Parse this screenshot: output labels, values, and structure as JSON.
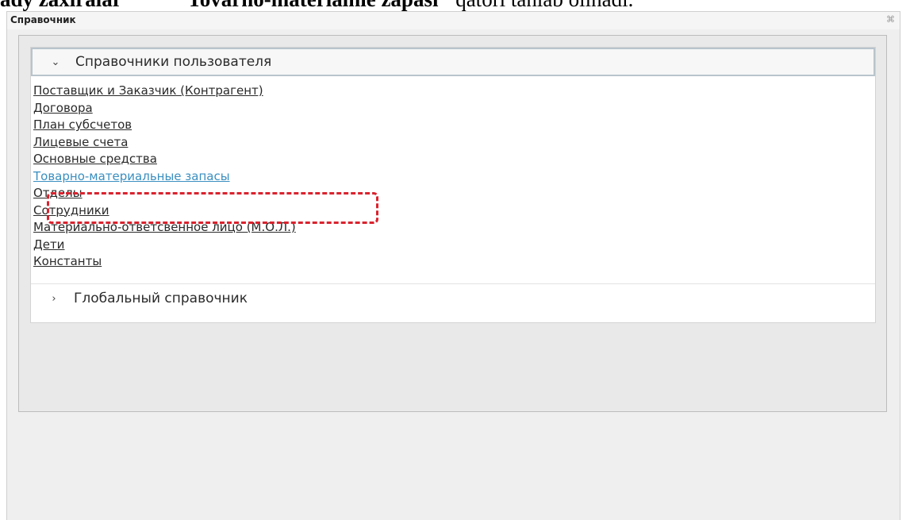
{
  "caption": {
    "part1": "ady zaxiralar",
    "part2": "\"Tovarno-materialnie zapasi\"",
    "part3": "qatori tanlab olinadi."
  },
  "window": {
    "title": "Справочник",
    "close_icon": "close-icon"
  },
  "sections": [
    {
      "label": "Справочники пользователя",
      "expanded": true,
      "items": [
        "Поставщик и Заказчик (Контрагент)",
        "Договора",
        "План субсчетов",
        "Лицевые счета",
        "Основные средства",
        "Товарно-материальные запасы",
        "Отделы",
        "Сотрудники",
        "Материально-ответсвенное лицо (М.О.Л.)",
        "Дети",
        "Константы"
      ],
      "highlighted_item": "Товарно-материальные запасы"
    },
    {
      "label": "Глобальный справочник",
      "expanded": false
    }
  ],
  "colors": {
    "highlight_border": "#d9232e",
    "active_link": "#3a8fc0"
  }
}
